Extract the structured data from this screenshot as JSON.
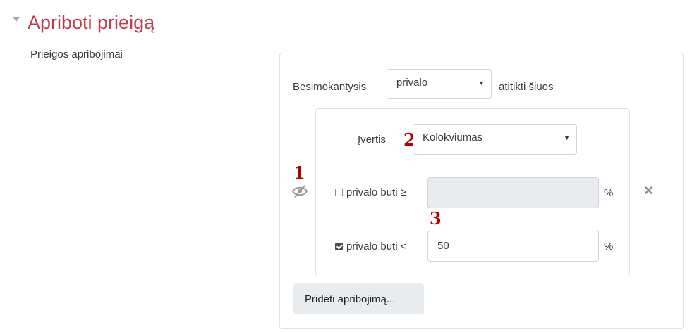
{
  "section": {
    "title": "Apriboti prieigą",
    "field_label": "Prieigos apribojimai"
  },
  "restriction": {
    "intro_prefix": "Besimokantysis",
    "must_select_value": "privalo",
    "intro_suffix": "atitikti šiuos",
    "grade_label": "Įvertis",
    "grade_select_value": "Kolokviumas",
    "min_checkbox_label": "privalo būti ≥",
    "min_checked": false,
    "min_value": "",
    "min_unit": "%",
    "max_checkbox_label": "privalo būti <",
    "max_checked": true,
    "max_value": "50",
    "max_unit": "%",
    "delete_icon": "×",
    "add_button_label": "Pridėti apribojimą..."
  },
  "annotations": {
    "marker_1": "1",
    "marker_2": "2",
    "marker_3": "3"
  },
  "colors": {
    "title": "#c43c4b",
    "annotation": "#b20000"
  }
}
